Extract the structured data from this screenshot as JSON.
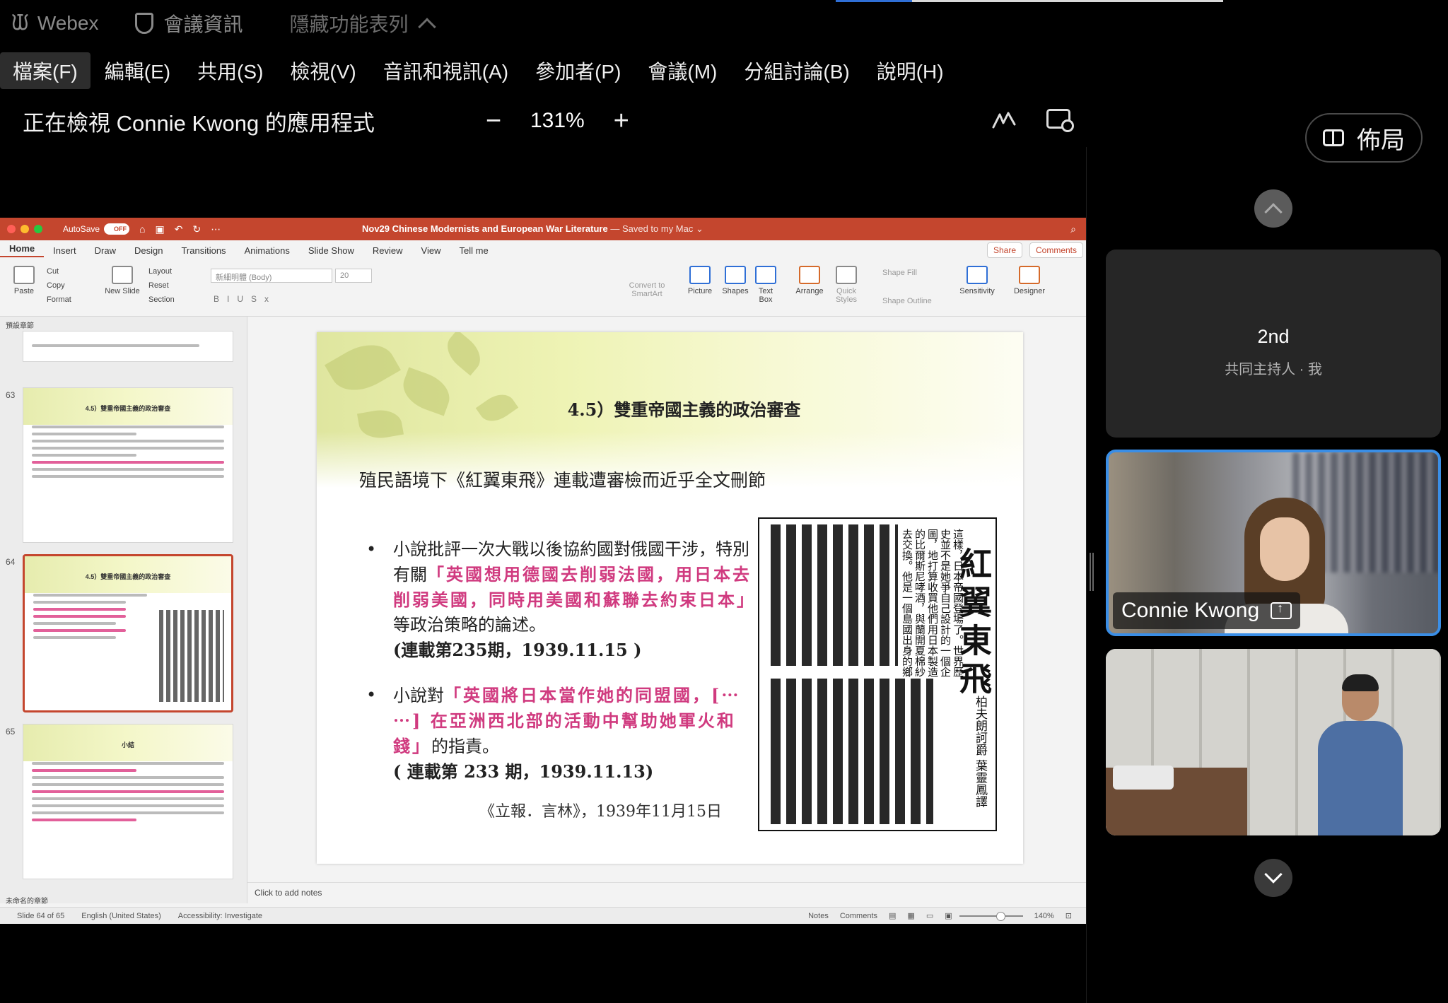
{
  "webex": {
    "app_name": "Webex",
    "meeting_info": "會議資訊",
    "hide_menu": "隱藏功能表列"
  },
  "menu": [
    "檔案(F)",
    "編輯(E)",
    "共用(S)",
    "檢視(V)",
    "音訊和視訊(A)",
    "參加者(P)",
    "會議(M)",
    "分組討論(B)",
    "說明(H)"
  ],
  "viewbar": {
    "title": "正在檢視 Connie Kwong 的應用程式",
    "zoom_out": "−",
    "zoom": "131%",
    "zoom_in": "+"
  },
  "ppt": {
    "autosave_label": "AutoSave",
    "autosave_state": "OFF",
    "doc_name": "Nov29 Chinese Modernists and European War Literature",
    "doc_status": " — Saved to my Mac ⌄",
    "tabs": [
      "Home",
      "Insert",
      "Draw",
      "Design",
      "Transitions",
      "Animations",
      "Slide Show",
      "Review",
      "View",
      "Tell me"
    ],
    "share": "Share",
    "comments": "Comments",
    "ribbon": {
      "paste": "Paste",
      "cut": "Cut",
      "copy": "Copy",
      "format": "Format",
      "new_slide": "New Slide",
      "layout": "Layout",
      "reset": "Reset",
      "section": "Section",
      "font": "新細明體 (Body)",
      "size": "20",
      "convert": "Convert to SmartArt",
      "picture": "Picture",
      "shapes": "Shapes",
      "textbox": "Text Box",
      "arrange": "Arrange",
      "quick_styles": "Quick Styles",
      "shape_fill": "Shape Fill",
      "shape_outline": "Shape Outline",
      "sensitivity": "Sensitivity",
      "designer": "Designer"
    },
    "section_top": "預設章節",
    "section_bottom": "未命名的章節",
    "thumbs": [
      {
        "num": "63",
        "title": "4.5）雙重帝國主義的政治審查"
      },
      {
        "num": "64",
        "title": "4.5）雙重帝國主義的政治審查"
      },
      {
        "num": "65",
        "title": "小結"
      }
    ],
    "notes": "Click to add notes",
    "status": {
      "slide": "Slide 64 of 65",
      "lang": "English (United States)",
      "access": "Accessibility: Investigate",
      "notes": "Notes",
      "comments": "Comments",
      "zoom": "140%"
    }
  },
  "slide": {
    "title": "4.5）雙重帝國主義的政治審查",
    "subtitle": "殖民語境下《紅翼東飛》連載遭審檢而近乎全文刪節",
    "b1_a": "小說批評一次大戰以後協約國對俄國干涉，特別有關",
    "b1_pink": "「英國想用德國去削弱法國，用日本去削弱美國，同時用美國和蘇聯去約束日本」",
    "b1_b": "等政治策略的論述。",
    "b1_c": "(連載第235期，1939.11.15 )",
    "b2_a": "小說對",
    "b2_pink": "「英國將日本當作她的同盟國，[⋯ ⋯] 在亞洲西北部的活動中幫助她軍火和錢」",
    "b2_b": "的指責。",
    "b2_c": "( 連載第 233 期，1939.11.13)",
    "source": "《立報．言林》，1939年11月15日",
    "news_title": "紅翼東飛",
    "news_author": "柏夫朗訶爵 葉靈鳳譯",
    "news_text": "這樣，日本帝國登場了。世界歷史並不是她爭自己設計的一個企圖，地打算收買他們用日本製造的比爾斯尼哮酒，與蘭開夏棉紗去交換。他是一個島國出身的鄉批漢族，從小就夢想古小說精神的行和征服。"
  },
  "panel": {
    "layout": "佈局",
    "me_name": "2nd",
    "me_role": "共同主持人 · 我",
    "speaker_name": "Connie Kwong"
  }
}
